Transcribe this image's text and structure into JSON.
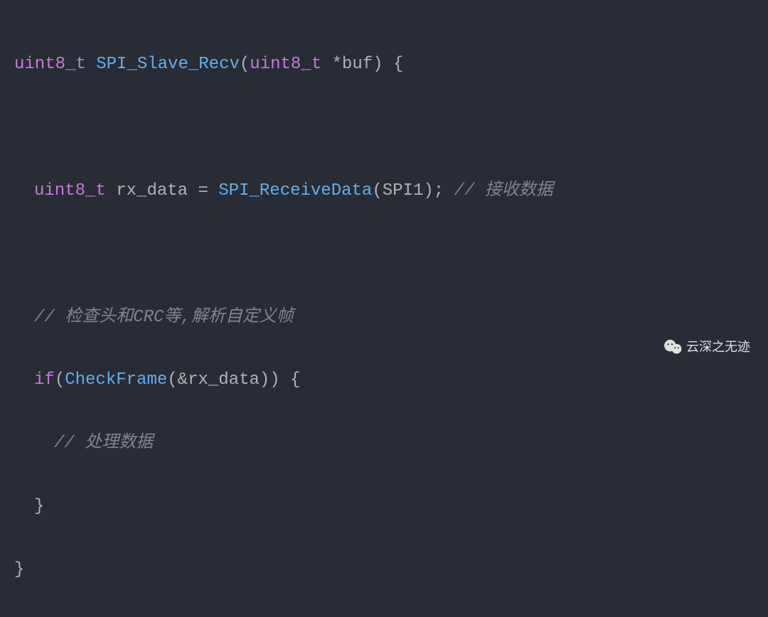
{
  "code": {
    "l1": {
      "type": "uint8_t",
      "func": "SPI_Slave_Recv",
      "paren_open": "(",
      "param_type": "uint8_t",
      "star": "*",
      "param_name": "buf",
      "paren_close": ")",
      "brace": " {"
    },
    "l3": {
      "type": "uint8_t",
      "var": "rx_data",
      "eq": " = ",
      "func": "SPI_ReceiveData",
      "paren_open": "(",
      "arg": "SPI1",
      "paren_close": ")",
      "semi": ";",
      "comment": " // 接收数据"
    },
    "l5": {
      "comment": "// 检查头和CRC等,解析自定义帧"
    },
    "l6": {
      "keyword": "if",
      "paren_open": "(",
      "func": "CheckFrame",
      "paren_open2": "(",
      "amp": "&",
      "var": "rx_data",
      "paren_close2": ")",
      "paren_close": ")",
      "brace": " {"
    },
    "l7": {
      "comment": "// 处理数据"
    },
    "l8": {
      "brace": "}"
    },
    "l9": {
      "brace": "}"
    }
  },
  "watermark": {
    "text": "云深之无迹"
  }
}
